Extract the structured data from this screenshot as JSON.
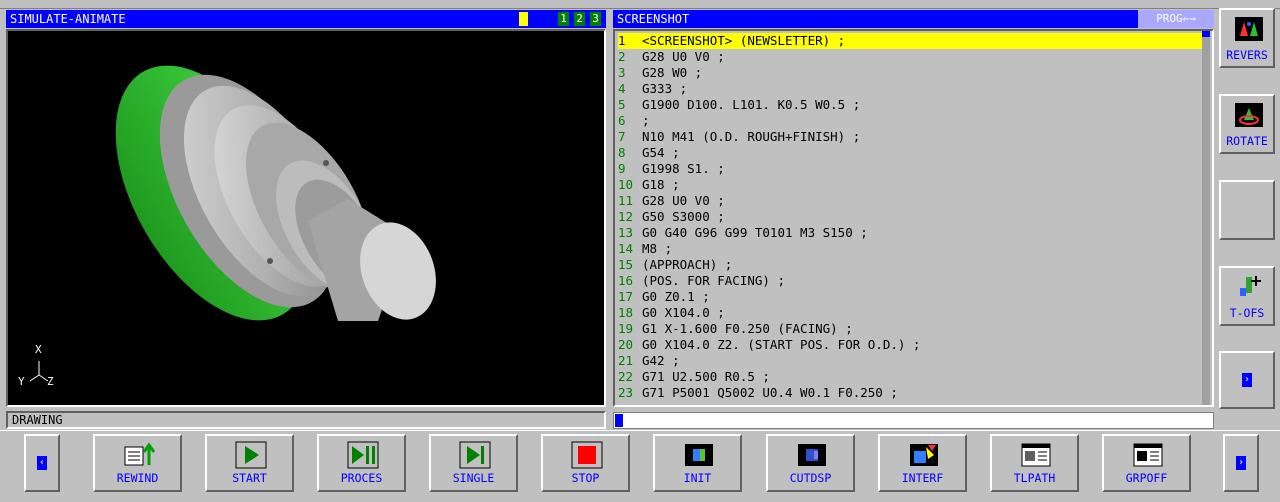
{
  "left_panel": {
    "title": "SIMULATE-ANIMATE",
    "view_buttons": [
      "1",
      "2",
      "3"
    ],
    "axes": {
      "x": "X",
      "y": "Y",
      "z": "Z"
    },
    "status_label": "DRAWING"
  },
  "right_panel": {
    "title": "SCREENSHOT",
    "mode": "PROG←→",
    "lines": [
      {
        "n": "1",
        "t": "<SCREENSHOT> (NEWSLETTER) ;"
      },
      {
        "n": "2",
        "t": "G28 U0 V0 ;"
      },
      {
        "n": "3",
        "t": "G28 W0 ;"
      },
      {
        "n": "4",
        "t": "G333 ;"
      },
      {
        "n": "5",
        "t": "G1900 D100. L101. K0.5 W0.5 ;"
      },
      {
        "n": "6",
        "t": ";"
      },
      {
        "n": "7",
        "t": "N10 M41 (O.D. ROUGH+FINISH) ;"
      },
      {
        "n": "8",
        "t": "G54 ;"
      },
      {
        "n": "9",
        "t": "G1998 S1. ;"
      },
      {
        "n": "10",
        "t": "G18 ;"
      },
      {
        "n": "11",
        "t": "G28 U0 V0 ;"
      },
      {
        "n": "12",
        "t": "G50 S3000 ;"
      },
      {
        "n": "13",
        "t": "G0 G40 G96 G99 T0101 M3 S150 ;"
      },
      {
        "n": "14",
        "t": "M8 ;"
      },
      {
        "n": "15",
        "t": "(APPROACH) ;"
      },
      {
        "n": "16",
        "t": "(POS. FOR FACING) ;"
      },
      {
        "n": "17",
        "t": "G0 Z0.1 ;"
      },
      {
        "n": "18",
        "t": "G0 X104.0 ;"
      },
      {
        "n": "19",
        "t": "G1 X-1.600 F0.250 (FACING) ;"
      },
      {
        "n": "20",
        "t": "G0 X104.0 Z2. (START POS. FOR O.D.) ;"
      },
      {
        "n": "21",
        "t": "G42 ;"
      },
      {
        "n": "22",
        "t": "G71 U2.500 R0.5 ;"
      },
      {
        "n": "23",
        "t": "G71 P5001 Q5002 U0.4 W0.1 F0.250 ;"
      }
    ]
  },
  "side_buttons": [
    {
      "label": "REVERS",
      "icon": "reverse-view-icon"
    },
    {
      "label": "ROTATE",
      "icon": "rotate-view-icon"
    },
    {
      "label": "",
      "icon": ""
    },
    {
      "label": "T-OFS",
      "icon": "tool-offset-icon"
    }
  ],
  "bottom_buttons": [
    {
      "label": "REWIND",
      "icon": "rewind-icon"
    },
    {
      "label": "START",
      "icon": "play-icon"
    },
    {
      "label": "PROCES",
      "icon": "play-pause-icon"
    },
    {
      "label": "SINGLE",
      "icon": "single-step-icon"
    },
    {
      "label": "STOP",
      "icon": "stop-icon"
    },
    {
      "label": "INIT",
      "icon": "init-icon"
    },
    {
      "label": "CUTDSP",
      "icon": "cut-display-icon"
    },
    {
      "label": "INTERF",
      "icon": "interference-icon"
    },
    {
      "label": "TLPATH",
      "icon": "tool-path-icon"
    },
    {
      "label": "GRPOFF",
      "icon": "graphic-off-icon"
    }
  ],
  "colors": {
    "titlebar": "#0000ff",
    "panel": "#c0c0c0",
    "highlight": "#ffff00",
    "line_number": "#008000",
    "label": "#0000ff"
  }
}
